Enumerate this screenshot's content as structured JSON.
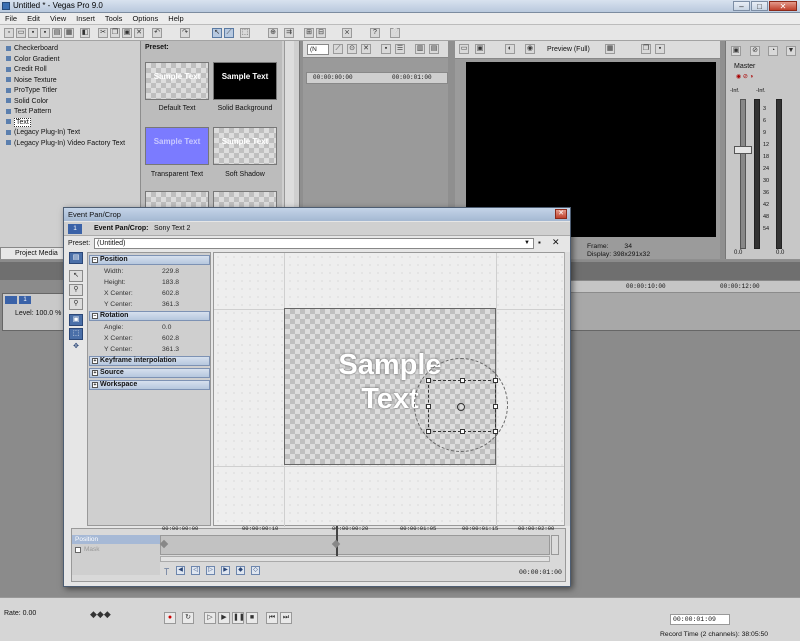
{
  "window": {
    "title": "Untitled * - Vegas Pro 9.0",
    "minimize_label": "–",
    "maximize_label": "□",
    "close_label": "✕"
  },
  "menu": [
    "File",
    "Edit",
    "View",
    "Insert",
    "Tools",
    "Options",
    "Help"
  ],
  "media_generators": {
    "items": [
      "Checkerboard",
      "Color Gradient",
      "Credit Roll",
      "Noise Texture",
      "ProType Titler",
      "Solid Color",
      "Test Pattern",
      "Text",
      "(Legacy Plug-In) Text",
      "(Legacy Plug-In) Video Factory Text"
    ],
    "selected": "Text",
    "preset_label": "Preset:",
    "presets": [
      {
        "name": "Default Text",
        "thumb_text": "Sample Text"
      },
      {
        "name": "Solid Background",
        "thumb_text": "Sample Text"
      },
      {
        "name": "Transparent Text",
        "thumb_text": "Sample Text"
      },
      {
        "name": "Soft Shadow",
        "thumb_text": "Sample Text"
      }
    ],
    "tab_label": "Project Media"
  },
  "trimmer": {
    "dropdown_value": "(N",
    "ruler_start": "00:00:00:00",
    "ruler_end": "00:00:01:00"
  },
  "preview": {
    "mode_label": "Preview (Full)",
    "frame_label": "Frame:",
    "frame_value": "34",
    "display_label": "Display:",
    "display_value": "398x291x32"
  },
  "master": {
    "label": "Master",
    "db_left": "-Inf.",
    "db_right": "-Inf.",
    "scale": [
      "3",
      "6",
      "9",
      "12",
      "18",
      "24",
      "30",
      "36",
      "42",
      "48",
      "54"
    ],
    "fader_left": "0.0",
    "fader_right": "0.0"
  },
  "timeline": {
    "ruler": [
      "00:00:10:00",
      "00:00:12:00"
    ],
    "track_level": "Level: 100.0 %"
  },
  "bottom": {
    "rate": "Rate: 0.00",
    "timecode": "00:00:01:09",
    "record_time": "Record Time (2 channels): 38:05:50"
  },
  "dialog": {
    "title": "Event Pan/Crop",
    "close_label": "✕",
    "event_number": "1",
    "header_bold": "Event Pan/Crop:",
    "header_value": "Sony Text 2",
    "preset_label": "Preset:",
    "preset_value": "(Untitled)",
    "groups": {
      "position": "Position",
      "rotation": "Rotation",
      "keyframe": "Keyframe interpolation",
      "source": "Source",
      "workspace": "Workspace"
    },
    "position_props": [
      {
        "label": "Width:",
        "value": "229.8"
      },
      {
        "label": "Height:",
        "value": "183.8"
      },
      {
        "label": "X Center:",
        "value": "602.8"
      },
      {
        "label": "Y Center:",
        "value": "361.3"
      }
    ],
    "rotation_props": [
      {
        "label": "Angle:",
        "value": "0.0"
      },
      {
        "label": "X Center:",
        "value": "602.8"
      },
      {
        "label": "Y Center:",
        "value": "361.3"
      }
    ],
    "canvas_text_line1": "Sample",
    "canvas_text_line2": "Text",
    "keyframe_ruler": [
      "00:00:00:00",
      "00:00:00:10",
      "00:00:00:20",
      "00:00:01:05",
      "00:00:01:15",
      "00:00:02:00"
    ],
    "keyframe_tracks": [
      "Position",
      "Mask"
    ],
    "keyframe_timecode": "00:00:01:00"
  },
  "colors": {
    "accent_blue": "#3a62a8",
    "selection_blue": "#4a6fa8",
    "preview_bg": "#000000",
    "transparent_thumb": "#7b7bff"
  }
}
